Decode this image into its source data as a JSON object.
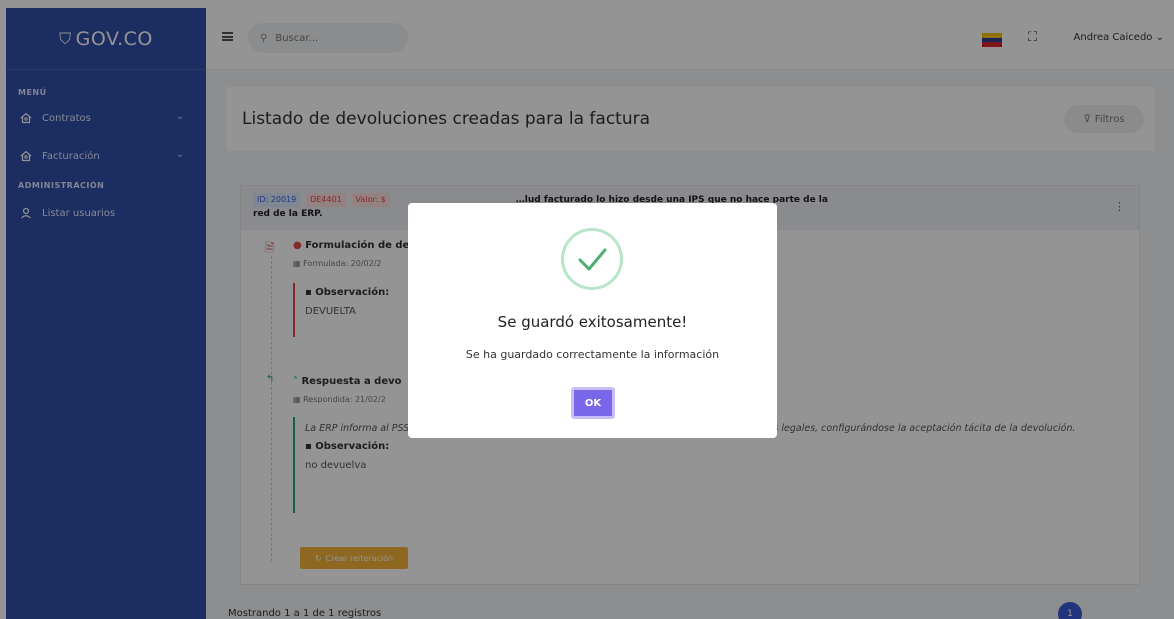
{
  "app": {
    "logo": "GOV.CO"
  },
  "sidebar": {
    "menu_title": "MENÚ",
    "items": [
      {
        "label": "Contratos",
        "icon": "home-icon"
      },
      {
        "label": "Facturación",
        "icon": "home-icon"
      }
    ],
    "admin_title": "ADMINISTRACIÓN",
    "admin_items": [
      {
        "label": "Listar usuarios",
        "icon": "user-icon"
      }
    ]
  },
  "topbar": {
    "search_placeholder": "Buscar...",
    "user_name": "Andrea Caicedo",
    "flag_colors": [
      "#f5c400",
      "#2a3f9b",
      "#d9262c"
    ]
  },
  "main": {
    "title": "Listado de devoluciones creadas para la factura",
    "filters_label": "Filtros",
    "card": {
      "id_badge": "ID: 20019",
      "code_badge": "DE4401",
      "value_badge": "Valor: $",
      "description": "…lud facturado lo hizo desde una IPS que no hace parte de la",
      "description_line2": "red de la ERP.",
      "entries": [
        {
          "title": "Formulación de de",
          "date": "Formulada: 20/02/2",
          "obs_label": "Observación:",
          "obs_value": "DEVUELTA"
        },
        {
          "title": "Respuesta a devo",
          "date": "Respondida: 21/02/2",
          "note": "La ERP informa al PSS o PTS que la respuesta a la devolución se presenta por fuera de los términos legales, configurándose la aceptación tácita de la devolución.",
          "obs_label": "Observación:",
          "obs_value": "no devuelva"
        }
      ],
      "reiteration_button": "Crear reiteración"
    },
    "footer": "Mostrando 1 a 1 de 1 registros",
    "current_page": "1"
  },
  "modal": {
    "title": "Se guardó exitosamente!",
    "message": "Se ha guardado correctamente la información",
    "ok_label": "OK",
    "check_color": "#4caf6e"
  }
}
